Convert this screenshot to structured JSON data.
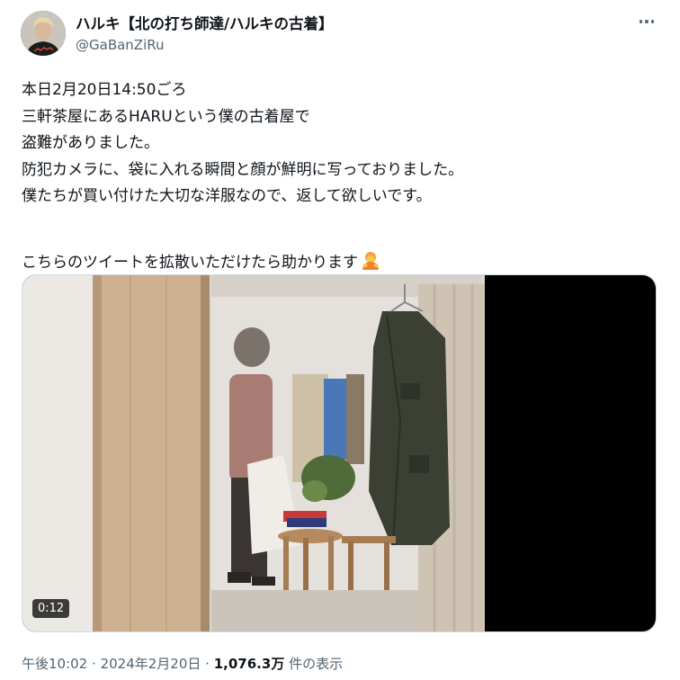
{
  "author": {
    "display_name": "ハルキ【北の打ち師達/ハルキの古着】",
    "handle": "@GaBanZiRu"
  },
  "tweet": {
    "lines": [
      "本日2月20日14:50ごろ",
      "三軒茶屋にあるHARUという僕の古着屋で",
      "盗難がありました。",
      "防犯カメラに、袋に入れる瞬間と顔が鮮明に写っておりました。",
      "僕たちが買い付けた大切な洋服なので、返して欲しいです。",
      "",
      "こちらのツイートを拡散いただけたら助かります"
    ],
    "emoji": "bowing-person-emoji"
  },
  "video": {
    "duration": "0:12"
  },
  "meta": {
    "time": "午後10:02",
    "separator": "·",
    "date": "2024年2月20日",
    "views_count": "1,076.3万",
    "views_label": "件の表示"
  },
  "icons": [
    "more-options-icon",
    "bowing-person-emoji"
  ]
}
